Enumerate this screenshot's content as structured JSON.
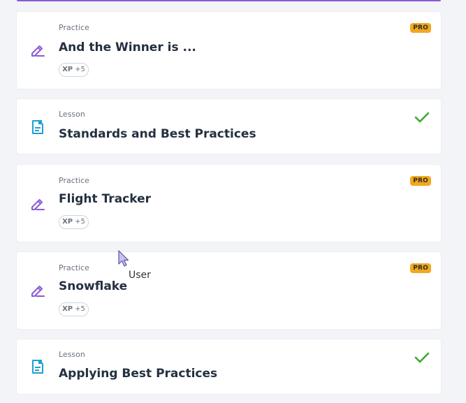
{
  "items": [
    {
      "kind": "Practice",
      "title": "And the Winner is ...",
      "badge": "PRO",
      "xp_label": "XP",
      "xp_value": "+5",
      "icon": "pencil-icon"
    },
    {
      "kind": "Lesson",
      "title": "Standards and Best Practices",
      "completed": true,
      "icon": "document-icon"
    },
    {
      "kind": "Practice",
      "title": "Flight Tracker",
      "badge": "PRO",
      "xp_label": "XP",
      "xp_value": "+5",
      "icon": "pencil-icon"
    },
    {
      "kind": "Practice",
      "title": "Snowflake",
      "badge": "PRO",
      "xp_label": "XP",
      "xp_value": "+5",
      "icon": "pencil-icon"
    },
    {
      "kind": "Lesson",
      "title": "Applying Best Practices",
      "completed": true,
      "icon": "document-icon"
    }
  ],
  "cursor": {
    "label": "User"
  },
  "colors": {
    "accent": "#8a5ad6",
    "lesson_icon": "#1f9fd6",
    "pro_badge": "#f2a81d",
    "check": "#3cab2d"
  }
}
